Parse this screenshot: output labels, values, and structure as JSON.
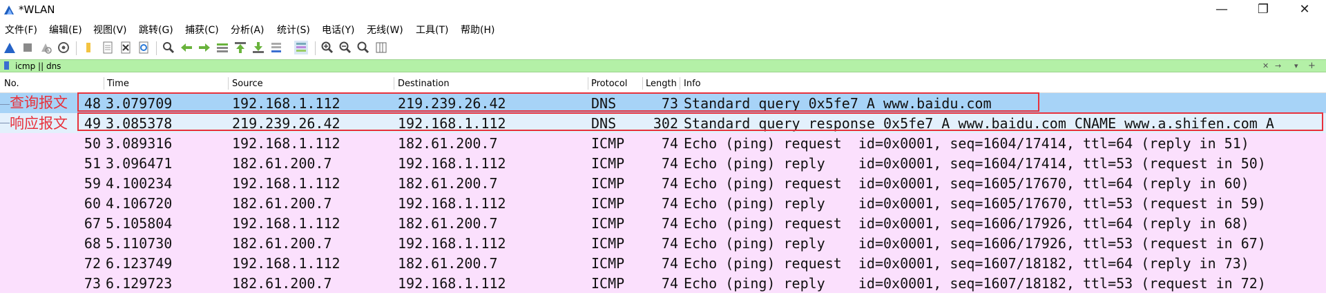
{
  "window": {
    "title": "*WLAN",
    "minimize_glyph": "—",
    "maximize_glyph": "❐",
    "close_glyph": "✕"
  },
  "menu": [
    {
      "label": "文件(F)"
    },
    {
      "label": "编辑(E)"
    },
    {
      "label": "视图(V)"
    },
    {
      "label": "跳转(G)"
    },
    {
      "label": "捕获(C)"
    },
    {
      "label": "分析(A)"
    },
    {
      "label": "统计(S)"
    },
    {
      "label": "电话(Y)"
    },
    {
      "label": "无线(W)"
    },
    {
      "label": "工具(T)"
    },
    {
      "label": "帮助(H)"
    }
  ],
  "toolbar": {
    "icons": [
      "shark-fin-start-icon",
      "stop-square-icon",
      "restart-icon",
      "capture-options-gear-icon",
      "open-file-icon",
      "file-icon",
      "close-file-icon",
      "reload-icon",
      "find-magnifier-icon",
      "back-arrow-icon",
      "forward-arrow-icon",
      "goto-packet-icon",
      "first-packet-icon",
      "last-packet-icon",
      "autoscroll-icon",
      "colorize-icon",
      "zoom-in-icon",
      "zoom-out-icon",
      "normal-size-icon",
      "resize-columns-icon"
    ]
  },
  "filter": {
    "value": "icmp || dns",
    "clear_glyph": "✕",
    "apply_glyph": "→",
    "dropdown_glyph": "▾",
    "add_glyph": "+"
  },
  "colors": {
    "dns_selected": "#a7d3f7",
    "dns_row": "#e3f0fc",
    "icmp_row": "#fbe0fd",
    "annotation": "#e8313b",
    "filter_bg": "#b4f0a7"
  },
  "packets": {
    "columns": [
      "No.",
      "Time",
      "Source",
      "Destination",
      "Protocol",
      "Length",
      "Info"
    ],
    "rows": [
      {
        "no": "48",
        "time": "3.079709",
        "src": "192.168.1.112",
        "dst": "219.239.26.42",
        "proto": "DNS",
        "len": "73",
        "info": "Standard query 0x5fe7 A www.baidu.com",
        "kind": "dns_selected"
      },
      {
        "no": "49",
        "time": "3.085378",
        "src": "219.239.26.42",
        "dst": "192.168.1.112",
        "proto": "DNS",
        "len": "302",
        "info": "Standard query response 0x5fe7 A www.baidu.com CNAME www.a.shifen.com A",
        "kind": "dns"
      },
      {
        "no": "50",
        "time": "3.089316",
        "src": "192.168.1.112",
        "dst": "182.61.200.7",
        "proto": "ICMP",
        "len": "74",
        "info": "Echo (ping) request  id=0x0001, seq=1604/17414, ttl=64 (reply in 51)",
        "kind": "icmp"
      },
      {
        "no": "51",
        "time": "3.096471",
        "src": "182.61.200.7",
        "dst": "192.168.1.112",
        "proto": "ICMP",
        "len": "74",
        "info": "Echo (ping) reply    id=0x0001, seq=1604/17414, ttl=53 (request in 50)",
        "kind": "icmp"
      },
      {
        "no": "59",
        "time": "4.100234",
        "src": "192.168.1.112",
        "dst": "182.61.200.7",
        "proto": "ICMP",
        "len": "74",
        "info": "Echo (ping) request  id=0x0001, seq=1605/17670, ttl=64 (reply in 60)",
        "kind": "icmp"
      },
      {
        "no": "60",
        "time": "4.106720",
        "src": "182.61.200.7",
        "dst": "192.168.1.112",
        "proto": "ICMP",
        "len": "74",
        "info": "Echo (ping) reply    id=0x0001, seq=1605/17670, ttl=53 (request in 59)",
        "kind": "icmp"
      },
      {
        "no": "67",
        "time": "5.105804",
        "src": "192.168.1.112",
        "dst": "182.61.200.7",
        "proto": "ICMP",
        "len": "74",
        "info": "Echo (ping) request  id=0x0001, seq=1606/17926, ttl=64 (reply in 68)",
        "kind": "icmp"
      },
      {
        "no": "68",
        "time": "5.110730",
        "src": "182.61.200.7",
        "dst": "192.168.1.112",
        "proto": "ICMP",
        "len": "74",
        "info": "Echo (ping) reply    id=0x0001, seq=1606/17926, ttl=53 (request in 67)",
        "kind": "icmp"
      },
      {
        "no": "72",
        "time": "6.123749",
        "src": "192.168.1.112",
        "dst": "182.61.200.7",
        "proto": "ICMP",
        "len": "74",
        "info": "Echo (ping) request  id=0x0001, seq=1607/18182, ttl=64 (reply in 73)",
        "kind": "icmp"
      },
      {
        "no": "73",
        "time": "6.129723",
        "src": "182.61.200.7",
        "dst": "192.168.1.112",
        "proto": "ICMP",
        "len": "74",
        "info": "Echo (ping) reply    id=0x0001, seq=1607/18182, ttl=53 (request in 72)",
        "kind": "icmp"
      }
    ]
  },
  "annotations": {
    "query_label": "查询报文",
    "response_label": "响应报文"
  }
}
